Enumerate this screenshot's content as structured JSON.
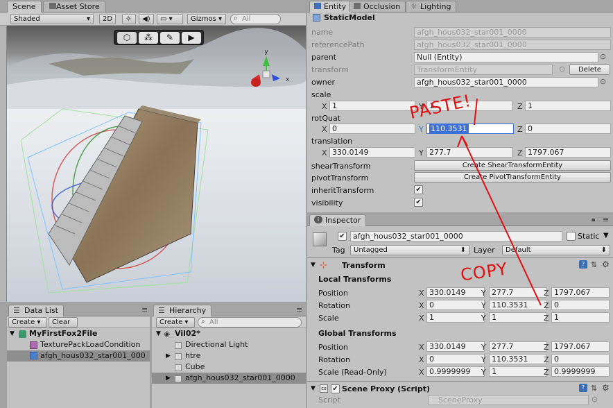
{
  "scene": {
    "tabs": [
      "Scene",
      "Asset Store"
    ],
    "shading": "Shaded",
    "mode_2d": "2D",
    "gizmos": "Gizmos",
    "search_placeholder": "All"
  },
  "entity_panel": {
    "tabs": [
      "Entity",
      "Occlusion",
      "Lighting"
    ],
    "title": "StaticModel",
    "rows": {
      "name_label": "name",
      "name_value": "afgh_hous032_star001_0000",
      "refpath_label": "referencePath",
      "refpath_value": "afgh_hous032_star001_0000",
      "parent_label": "parent",
      "parent_value": "Null (Entity)",
      "transform_label": "transform",
      "transform_value": "TransformEntity",
      "delete_label": "Delete",
      "owner_label": "owner",
      "owner_value": "afgh_hous032_star001_0000",
      "scale_label": "scale",
      "scale_x": "1",
      "scale_y": "1",
      "scale_z": "1",
      "rotquat_label": "rotQuat",
      "rot_x": "0",
      "rot_y": "110.3531",
      "rot_z": "0",
      "translation_label": "translation",
      "tr_x": "330.0149",
      "tr_y": "277.7",
      "tr_z": "1797.067",
      "shear_label": "shearTransform",
      "shear_button": "Create ShearTransformEntity",
      "pivot_label": "pivotTransform",
      "pivot_button": "Create PivotTransformEntity",
      "inherit_label": "inheritTransform",
      "visibility_label": "visibility"
    }
  },
  "inspector": {
    "tab": "Inspector",
    "object_name": "afgh_hous032_star001_0000",
    "static_label": "Static",
    "tag_label": "Tag",
    "tag_value": "Untagged",
    "layer_label": "Layer",
    "layer_value": "Default",
    "transform_title": "Transform",
    "local_title": "Local Transforms",
    "global_title": "Global Transforms",
    "position_label": "Position",
    "rotation_label": "Rotation",
    "scale_label": "Scale",
    "scale_ro_label": "Scale (Read-Only)",
    "local": {
      "pos": [
        "330.0149",
        "277.7",
        "1797.067"
      ],
      "rot": [
        "0",
        "110.3531",
        "0"
      ],
      "scale": [
        "1",
        "1",
        "1"
      ]
    },
    "global": {
      "pos": [
        "330.0149",
        "277.7",
        "1797.067"
      ],
      "rot": [
        "0",
        "110.3531",
        "0"
      ],
      "scale": [
        "0.9999999",
        "1",
        "0.9999999"
      ]
    },
    "proxy_title": "Scene Proxy (Script)",
    "script_label": "Script",
    "script_value": "SceneProxy"
  },
  "datalist": {
    "tab": "Data List",
    "create": "Create",
    "clear": "Clear",
    "items": [
      "MyFirstFox2File",
      "TexturePackLoadCondition",
      "afgh_hous032_star001_000"
    ]
  },
  "hierarchy": {
    "tab": "Hierarchy",
    "create": "Create",
    "search_placeholder": "All",
    "scene_name": "Vil02*",
    "items": [
      "Directional Light",
      "htre",
      "Cube",
      "afgh_hous032_star001_0000"
    ]
  },
  "annotations": {
    "paste": "PASTE!",
    "copy": "COPY"
  },
  "axis_letters": {
    "x": "X",
    "y": "Y",
    "z": "Z"
  },
  "colors": {
    "selection": "#3d6fd6",
    "annotation": "#e01010"
  }
}
